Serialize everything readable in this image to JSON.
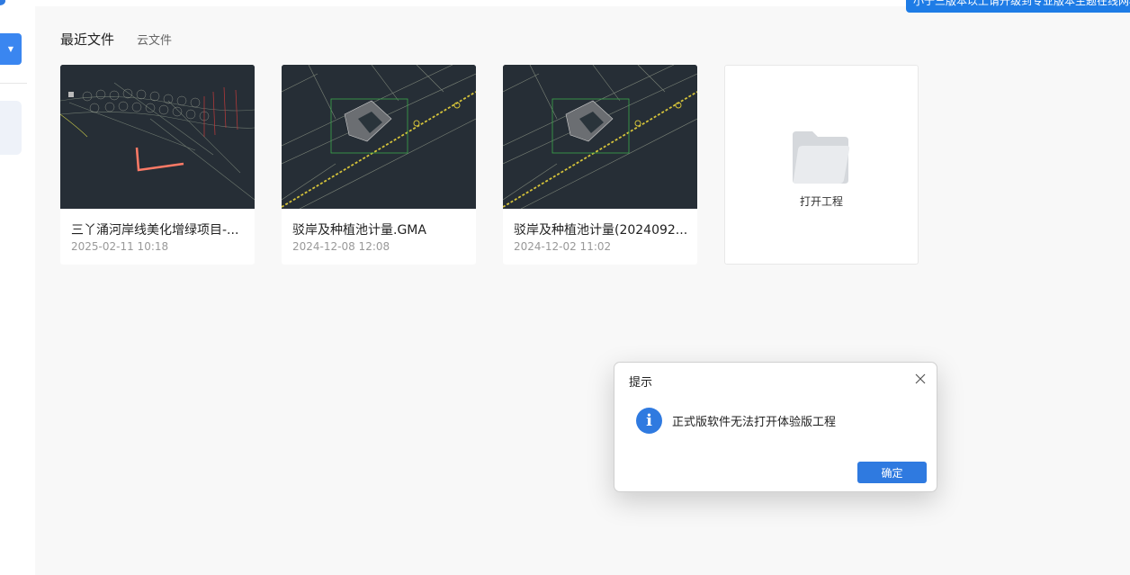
{
  "header": {
    "banner_text": "小于三版本以上请升级到专业版本主题在线网格"
  },
  "sidebar": {
    "dropdown_icon": "caret-down-icon"
  },
  "tabs": [
    {
      "label": "最近文件",
      "active": true
    },
    {
      "label": "云文件",
      "active": false
    }
  ],
  "recent_files": [
    {
      "name": "三丫涌河岸线美化增绿项目-...",
      "date": "2025-02-11 10:18"
    },
    {
      "name": "驳岸及种植池计量.GMA",
      "date": "2024-12-08 12:08"
    },
    {
      "name": "驳岸及种植池计量(2024092...",
      "date": "2024-12-02 11:02"
    }
  ],
  "open_project": {
    "label": "打开工程",
    "icon": "folder-icon"
  },
  "dialog": {
    "title": "提示",
    "message": "正式版软件无法打开体验版工程",
    "ok_label": "确定",
    "icon": "info-icon"
  },
  "colors": {
    "accent": "#2f7ae0",
    "cad_background": "#262e36",
    "main_background": "#f8f8f8"
  }
}
